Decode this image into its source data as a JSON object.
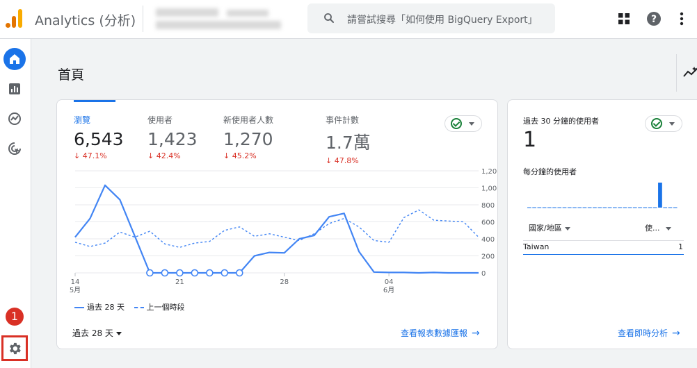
{
  "header": {
    "app_title": "Analytics (分析)",
    "search_placeholder": "請嘗試搜尋「如何使用 BigQuery Export」"
  },
  "page": {
    "title": "首頁"
  },
  "sidebar": {
    "items": [
      {
        "name": "home",
        "icon": "home-icon"
      },
      {
        "name": "reports",
        "icon": "bar-chart-icon"
      },
      {
        "name": "explore",
        "icon": "explore-icon"
      },
      {
        "name": "advertising",
        "icon": "target-cursor-icon"
      }
    ],
    "notification_badge": "1",
    "settings_icon": "gear-icon"
  },
  "metrics": [
    {
      "label": "瀏覽",
      "value": "6,543",
      "delta": "↓ 47.1%"
    },
    {
      "label": "使用者",
      "value": "1,423",
      "delta": "↓ 42.4%"
    },
    {
      "label": "新使用者人數",
      "value": "1,270",
      "delta": "↓ 45.2%"
    },
    {
      "label": "事件計數",
      "value": "1.7萬",
      "delta": "↓ 47.8%"
    }
  ],
  "chart_data": {
    "type": "line",
    "y_tick_labels": [
      "1,200",
      "1,000",
      "800",
      "600",
      "400",
      "200",
      "0"
    ],
    "y_ticks": [
      1200,
      1000,
      800,
      600,
      400,
      200,
      0
    ],
    "ylim": [
      0,
      1200
    ],
    "x_ticks": [
      {
        "day": 0,
        "label": "14",
        "sub": "5月"
      },
      {
        "day": 7,
        "label": "21",
        "sub": ""
      },
      {
        "day": 14,
        "label": "28",
        "sub": ""
      },
      {
        "day": 21,
        "label": "04",
        "sub": "6月"
      }
    ],
    "series": [
      {
        "name": "過去 28 天",
        "style": "solid",
        "values": [
          420,
          640,
          1030,
          860,
          430,
          0,
          0,
          0,
          0,
          0,
          0,
          0,
          200,
          240,
          235,
          400,
          440,
          660,
          700,
          250,
          10,
          5,
          5,
          0,
          5,
          0,
          0,
          0
        ]
      },
      {
        "name": "上一個時段",
        "style": "dashed",
        "values": [
          360,
          310,
          350,
          480,
          420,
          490,
          340,
          300,
          350,
          370,
          500,
          540,
          430,
          460,
          420,
          380,
          460,
          580,
          640,
          540,
          380,
          360,
          650,
          740,
          620,
          610,
          600,
          420
        ]
      }
    ],
    "grid": true,
    "legend": "bottom-left"
  },
  "main_card": {
    "legend_current": "過去 28 天",
    "legend_previous": "上一個時段",
    "range_label": "過去 28 天",
    "report_link": "查看報表數據匯報"
  },
  "realtime_card": {
    "title": "過去 30 分鐘的使用者",
    "value": "1",
    "per_minute_label": "每分鐘的使用者",
    "bar_values": [
      0,
      0,
      0,
      0,
      0,
      0,
      0,
      0,
      0,
      0,
      0,
      0,
      0,
      0,
      0,
      0,
      0,
      0,
      0,
      0,
      0,
      0,
      0,
      0,
      0,
      0,
      1,
      0,
      0,
      0
    ],
    "col_country": "國家/地區",
    "col_users": "使...",
    "rows": [
      {
        "country": "Taiwan",
        "users": "1"
      }
    ],
    "link": "查看即時分析"
  },
  "colors": {
    "accent": "#1a73e8",
    "negative": "#d93025",
    "series": "#4285f4"
  }
}
